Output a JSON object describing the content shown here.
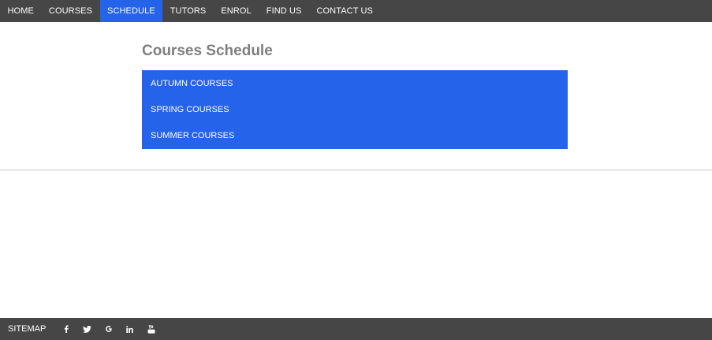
{
  "nav": {
    "items": [
      {
        "label": "HOME",
        "active": false
      },
      {
        "label": "COURSES",
        "active": false
      },
      {
        "label": "SCHEDULE",
        "active": true
      },
      {
        "label": "TUTORS",
        "active": false
      },
      {
        "label": "ENROL",
        "active": false
      },
      {
        "label": "FIND US",
        "active": false
      },
      {
        "label": "CONTACT US",
        "active": false
      }
    ]
  },
  "main": {
    "title": "Courses Schedule",
    "courses": [
      {
        "label": "AUTUMN COURSES"
      },
      {
        "label": "SPRING COURSES"
      },
      {
        "label": "SUMMER COURSES"
      }
    ]
  },
  "footer": {
    "sitemap_label": "SITEMAP",
    "social": [
      {
        "icon": "facebook-icon"
      },
      {
        "icon": "twitter-icon"
      },
      {
        "icon": "google-icon"
      },
      {
        "icon": "linkedin-icon"
      },
      {
        "icon": "youtube-icon"
      }
    ]
  },
  "colors": {
    "nav_background": "#464646",
    "accent": "#2563eb",
    "title": "#7f7f7f"
  }
}
